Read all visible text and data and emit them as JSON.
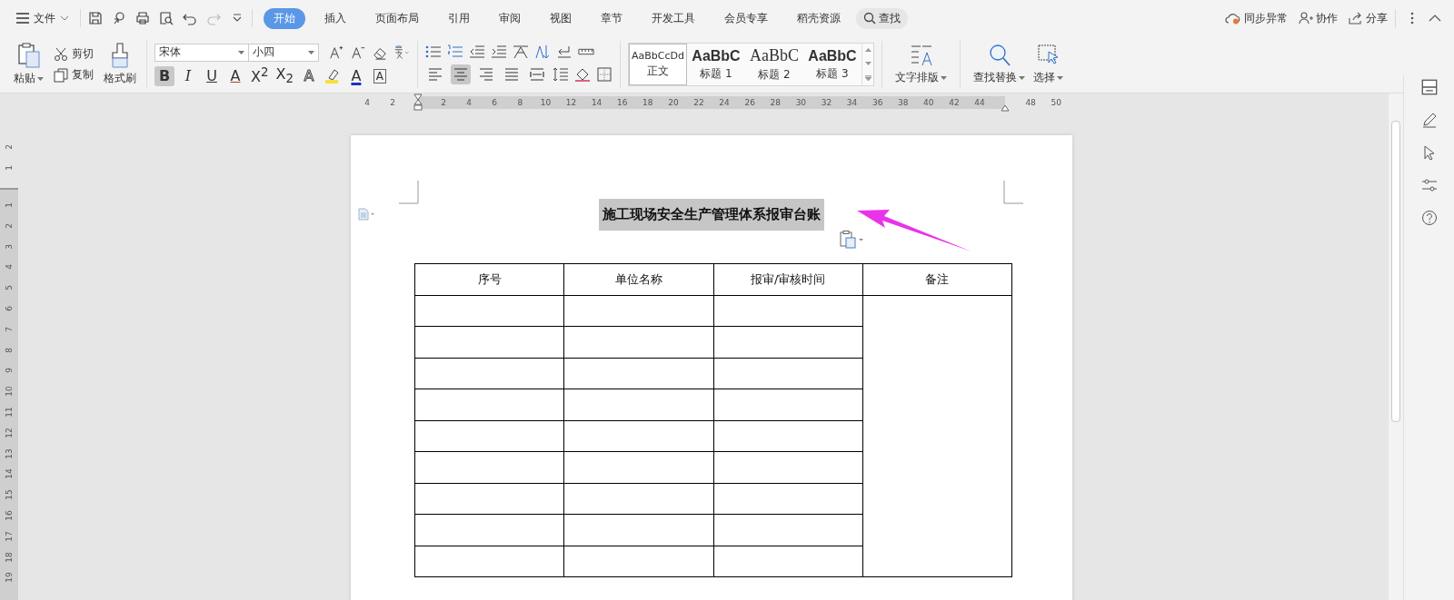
{
  "menu_bar": {
    "file_menu": "文件",
    "tabs": [
      {
        "label": "开始",
        "selected": true
      },
      {
        "label": "插入",
        "selected": false
      },
      {
        "label": "页面布局",
        "selected": false
      },
      {
        "label": "引用",
        "selected": false
      },
      {
        "label": "审阅",
        "selected": false
      },
      {
        "label": "视图",
        "selected": false
      },
      {
        "label": "章节",
        "selected": false
      },
      {
        "label": "开发工具",
        "selected": false
      },
      {
        "label": "会员专享",
        "selected": false
      },
      {
        "label": "稻壳资源",
        "selected": false
      }
    ],
    "search": "查找",
    "sync_status": "同步异常",
    "collaborate": "协作",
    "share": "分享"
  },
  "ribbon": {
    "paste": "粘贴",
    "cut": "剪切",
    "copy": "复制",
    "format_painter": "格式刷",
    "font_name": "宋体",
    "font_size": "小四",
    "format_buttons": [
      {
        "kind": "bold",
        "label": "B",
        "selected": true
      },
      {
        "kind": "italic",
        "label": "I",
        "selected": false
      },
      {
        "kind": "underline",
        "label": "U",
        "selected": false
      },
      {
        "kind": "strike",
        "label": "A",
        "selected": false
      },
      {
        "kind": "script",
        "label": "X$^{2}$",
        "selected": false
      },
      {
        "kind": "script",
        "label": "X$_{2}$",
        "selected": false
      },
      {
        "kind": "effect",
        "label": "A",
        "selected": false
      },
      {
        "kind": "highlight",
        "selected": false
      },
      {
        "kind": "color",
        "label": "A",
        "selected": false
      },
      {
        "kind": "border",
        "label": "A",
        "selected": false
      }
    ],
    "align_buttons": [
      {
        "selected": false
      },
      {
        "selected": true
      },
      {
        "selected": false
      },
      {
        "selected": false
      },
      {
        "selected": false
      }
    ],
    "styles": [
      {
        "kind": "body",
        "sample": "AaBbCcDd",
        "name": "正文",
        "selected": true
      },
      {
        "kind": "heading-sans",
        "sample": "AaBbC",
        "name": "标题 1",
        "selected": false
      },
      {
        "kind": "heading-serif",
        "sample": "AaBbC",
        "name": "标题 2",
        "selected": false
      },
      {
        "kind": "heading-sans",
        "sample": "AaBbC",
        "name": "标题 3",
        "selected": false
      }
    ],
    "text_layout": "文字排版",
    "find_replace": "查找替换",
    "select": "选择"
  },
  "ruler": {
    "left_numbers": [
      "4",
      "2"
    ],
    "numbers": [
      "2",
      "4",
      "6",
      "8",
      "10",
      "12",
      "14",
      "16",
      "18",
      "20",
      "22",
      "24",
      "26",
      "28",
      "30",
      "32",
      "34",
      "36",
      "38",
      "40",
      "42",
      "44"
    ],
    "right_numbers": [
      "48",
      "50"
    ]
  },
  "vertical_ruler": {
    "top_numbers": [
      "2",
      "1"
    ],
    "numbers": [
      "1",
      "2",
      "3",
      "4",
      "5",
      "6",
      "7",
      "8",
      "9",
      "10",
      "11",
      "12",
      "13",
      "14",
      "15",
      "16",
      "17",
      "18",
      "19"
    ]
  },
  "document": {
    "title": "施工现场安全生产管理体系报审台账",
    "title_selected": true,
    "table": {
      "columns": [
        "序号",
        "单位名称",
        "报审/审核时间",
        "备注"
      ]
    }
  }
}
